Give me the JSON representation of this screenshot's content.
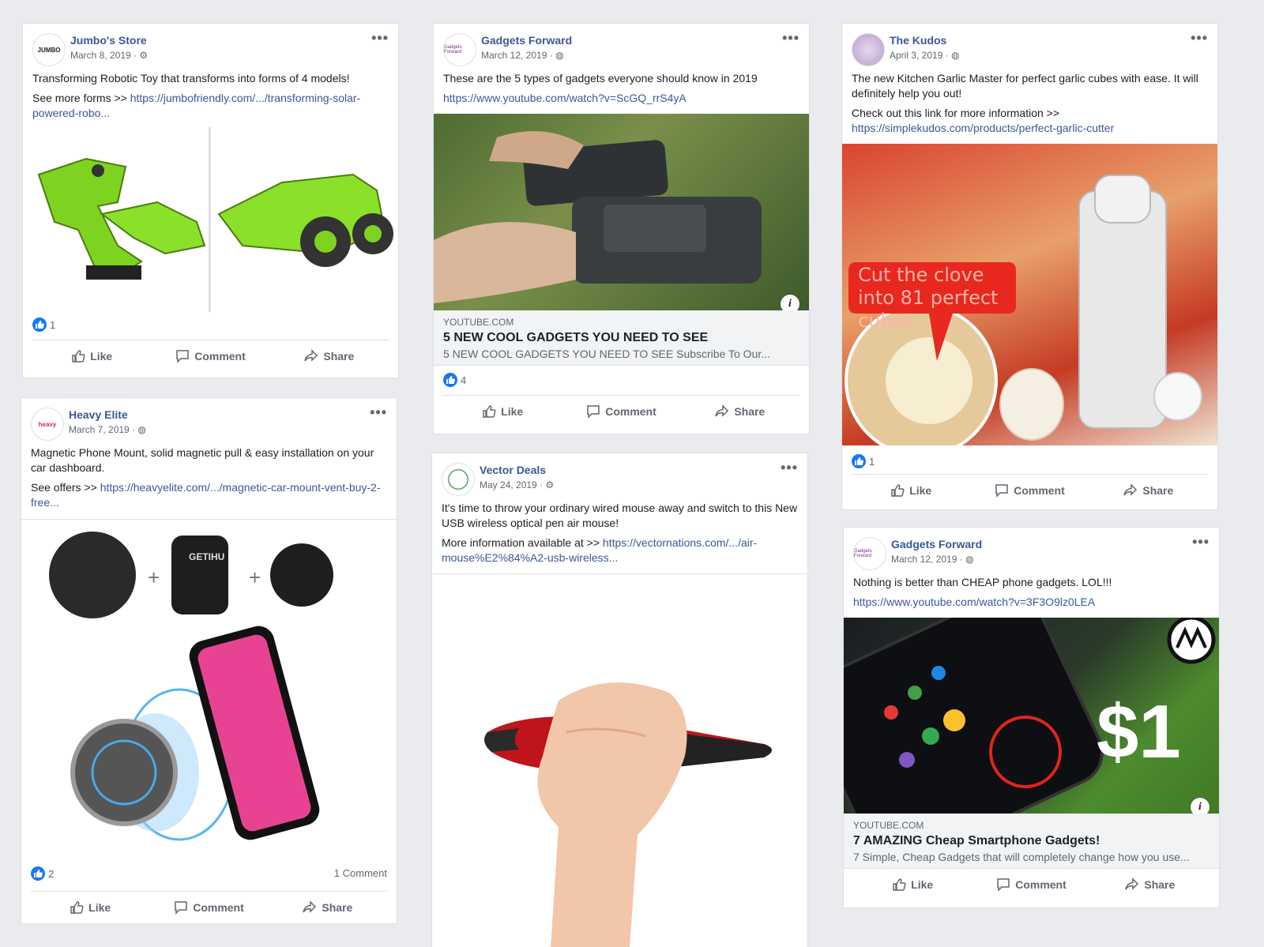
{
  "colors": {
    "link": "#385898",
    "like_blue": "#1877f2",
    "background": "#e9ebee"
  },
  "actions": {
    "like": "Like",
    "comment": "Comment",
    "share": "Share"
  },
  "posts": [
    {
      "page": "Jumbo's Store",
      "date": "March 8, 2019 ·",
      "privacy_icon": "gear-icon",
      "avatar_text": "JUMBO",
      "text": "Transforming Robotic Toy that transforms into forms of 4 models!",
      "see_more": "See more forms >> ",
      "url": "https://jumbofriendly.com/.../transforming-solar-powered-robo...",
      "likes": "1"
    },
    {
      "page": "Gadgets Forward",
      "date": "March 12, 2019 ·",
      "privacy_icon": "globe-icon",
      "avatar_text": "Gadgets Forward",
      "text": "These are the 5 types of gadgets everyone should know in 2019",
      "url": "https://www.youtube.com/watch?v=ScGQ_rrS4yA",
      "link_domain": "YOUTUBE.COM",
      "link_title": "5 NEW COOL GADGETS YOU NEED TO SEE",
      "link_desc": "5 NEW COOL GADGETS YOU NEED TO SEE Subscribe To Our...",
      "likes": "4"
    },
    {
      "page": "The Kudos",
      "date": "April 3, 2019 ·",
      "privacy_icon": "globe-icon",
      "text": "The new Kitchen Garlic Master for perfect garlic cubes with ease. It will definitely help you out!",
      "see_more": "Check out this link for more information >>",
      "url": "https://simplekudos.com/products/perfect-garlic-cutter",
      "image_caption": "Cut the clove into 81 perfect cubes",
      "likes": "1"
    },
    {
      "page": "Heavy Elite",
      "date": "March 7, 2019 ·",
      "privacy_icon": "globe-icon",
      "avatar_text": "heavy",
      "text": "Magnetic Phone Mount, solid magnetic pull & easy installation on your car dashboard.",
      "see_more": "See offers >> ",
      "url": "https://heavyelite.com/.../magnetic-car-mount-vent-buy-2-free...",
      "brand": "GETIHU",
      "likes": "2",
      "comments": "1 Comment"
    },
    {
      "page": "Vector Deals",
      "date": "May 24, 2019 ·",
      "privacy_icon": "gear-icon",
      "text": "It's time to throw your ordinary wired mouse away and switch to this New USB wireless optical pen air mouse!",
      "see_more": "More information available at >> ",
      "url": "https://vectornations.com/.../air-mouse%E2%84%A2-usb-wireless..."
    },
    {
      "page": "Gadgets Forward",
      "date": "March 12, 2019 ·",
      "privacy_icon": "globe-icon",
      "avatar_text": "Gadgets Forward",
      "text": "Nothing is better than CHEAP phone gadgets. LOL!!!",
      "url": "https://www.youtube.com/watch?v=3F3O9lz0LEA",
      "image_price": "$1",
      "link_domain": "YOUTUBE.COM",
      "link_title": "7 AMAZING Cheap Smartphone Gadgets!",
      "link_desc": "7 Simple, Cheap Gadgets that will completely change how you use..."
    }
  ]
}
